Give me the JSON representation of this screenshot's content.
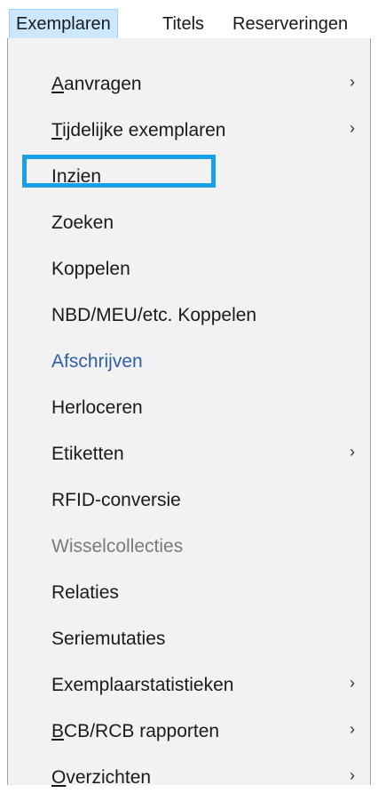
{
  "menubar": {
    "items": [
      {
        "label": "Exemplaren",
        "active": true
      },
      {
        "label": "Titels",
        "active": false
      },
      {
        "label": "Reserveringen",
        "active": false
      }
    ]
  },
  "dropdown": {
    "items": [
      {
        "mnemonic": "A",
        "rest": "anvragen",
        "submenu": true,
        "state": "normal"
      },
      {
        "mnemonic": "T",
        "rest": "ijdelijke exemplaren",
        "submenu": true,
        "state": "normal"
      },
      {
        "mnemonic": "",
        "rest": "Inzien",
        "submenu": false,
        "state": "normal",
        "highlighted": true
      },
      {
        "mnemonic": "",
        "rest": "Zoeken",
        "submenu": false,
        "state": "normal"
      },
      {
        "mnemonic": "",
        "rest": "Koppelen",
        "submenu": false,
        "state": "normal"
      },
      {
        "mnemonic": "",
        "rest": "NBD/MEU/etc. Koppelen",
        "submenu": false,
        "state": "normal"
      },
      {
        "mnemonic": "",
        "rest": "Afschrijven",
        "submenu": false,
        "state": "link"
      },
      {
        "mnemonic": "",
        "rest": "Herloceren",
        "submenu": false,
        "state": "normal"
      },
      {
        "mnemonic": "",
        "rest": "Etiketten",
        "submenu": true,
        "state": "normal"
      },
      {
        "mnemonic": "",
        "rest": "RFID-conversie",
        "submenu": false,
        "state": "normal"
      },
      {
        "mnemonic": "",
        "rest": "Wisselcollecties",
        "submenu": false,
        "state": "disabled"
      },
      {
        "mnemonic": "",
        "rest": "Relaties",
        "submenu": false,
        "state": "normal"
      },
      {
        "mnemonic": "",
        "rest": "Seriemutaties",
        "submenu": false,
        "state": "normal"
      },
      {
        "mnemonic": "",
        "rest": "Exemplaarstatistieken",
        "submenu": true,
        "state": "normal"
      },
      {
        "mnemonic": "B",
        "rest": "CB/RCB rapporten",
        "submenu": true,
        "state": "normal"
      },
      {
        "mnemonic": "O",
        "rest": "verzichten",
        "submenu": true,
        "state": "normal"
      }
    ],
    "submenu_arrow": "›"
  },
  "colors": {
    "menubar_active_bg": "#cce8ff",
    "dropdown_bg": "#f2f2f2",
    "link_text": "#2e5ea8",
    "disabled_text": "#7a7a7a",
    "highlight_box": "#1aa0e6"
  }
}
